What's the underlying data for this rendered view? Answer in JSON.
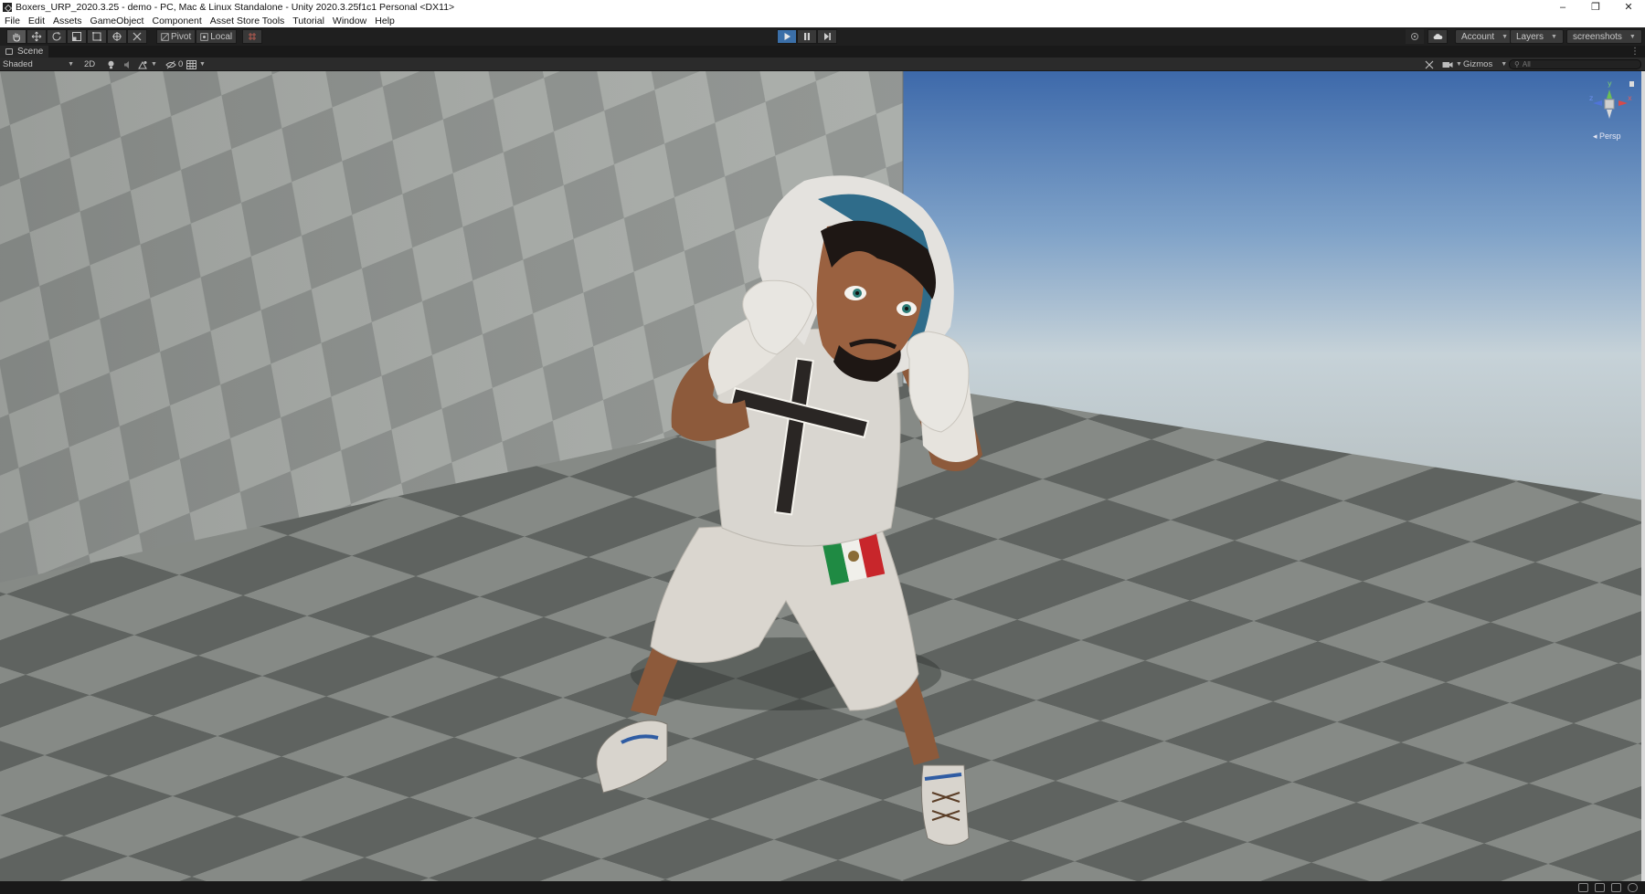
{
  "window": {
    "title": "Boxers_URP_2020.3.25 - demo - PC, Mac & Linux Standalone - Unity 2020.3.25f1c1 Personal <DX11>",
    "controls": {
      "minimize": "–",
      "restore": "❐",
      "close": "✕"
    }
  },
  "menu": [
    "File",
    "Edit",
    "Assets",
    "GameObject",
    "Component",
    "Asset Store Tools",
    "Tutorial",
    "Window",
    "Help"
  ],
  "toolbar": {
    "transform_tools": [
      "hand-tool",
      "move-tool",
      "rotate-tool",
      "scale-tool",
      "rect-tool",
      "transform-tool",
      "custom-tool"
    ],
    "pivot_label": "Pivot",
    "local_label": "Local",
    "play_controls": [
      "play",
      "pause",
      "step"
    ],
    "account_label": "Account",
    "layers_label": "Layers",
    "layout_label": "screenshots"
  },
  "scene_tab": {
    "label": "Scene",
    "more": "⋮"
  },
  "scene_toolbar": {
    "draw_mode": "Shaded",
    "toggle_2d": "2D",
    "hidden_count": "0",
    "gizmos_label": "Gizmos",
    "search_placeholder": "All"
  },
  "gizmo": {
    "axes": [
      "y",
      "x",
      "z"
    ],
    "projection": "Persp"
  },
  "colors": {
    "toolbar_bg": "#1f1f1f",
    "play_active": "#3b6fa8",
    "sky_top": "#3d69aa",
    "floor_light": "#8a8e8a",
    "floor_dark": "#5f6360"
  }
}
